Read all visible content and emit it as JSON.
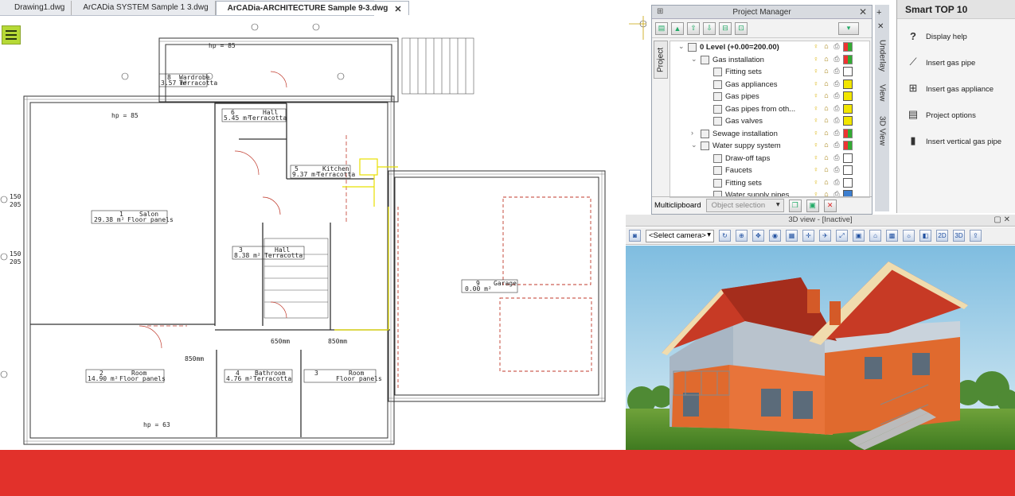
{
  "tabs": [
    {
      "label": "Drawing1.dwg"
    },
    {
      "label": "ArCADia SYSTEM Sample 1 3.dwg"
    },
    {
      "label": "ArCADia-ARCHITECTURE Sample 9-3.dwg",
      "active": true
    }
  ],
  "tab_close_glyph": "✕",
  "drawing": {
    "rooms": [
      {
        "num": "1",
        "name": "Salon",
        "area": "29.38 m²",
        "floor": "Floor panels"
      },
      {
        "num": "8",
        "name": "Wardrobe",
        "area": "3.57 m²",
        "floor": "Terracotta"
      },
      {
        "num": "6",
        "name": "Hall",
        "area": "5.45 m²",
        "floor": "Terracotta"
      },
      {
        "num": "5",
        "name": "Kitchen",
        "area": "9.37 m²",
        "floor": "Terracotta"
      },
      {
        "num": "3",
        "name": "Hall",
        "area": "8.38 m²",
        "floor": "Terracotta"
      },
      {
        "num": "2",
        "name": "Room",
        "area": "14.90 m²",
        "floor": "Floor panels"
      },
      {
        "num": "4",
        "name": "Bathroom",
        "area": "4.76 m²",
        "floor": "Terracotta"
      },
      {
        "num": "3",
        "name": "Room",
        "area": "",
        "floor": "Floor panels"
      },
      {
        "num": "9",
        "name": "Garage",
        "area": "0.00 m²",
        "floor": ""
      }
    ],
    "hp_labels": [
      "hp = 85",
      "hp = 63",
      "hp = 85"
    ],
    "dims": [
      "150",
      "205",
      "150",
      "205",
      "850mm",
      "650mm",
      "850mm"
    ]
  },
  "project_manager": {
    "title": "Project Manager",
    "side_tab": "Project",
    "vertical_tabs": [
      "Underlay",
      "View",
      "3D View"
    ],
    "tree": [
      {
        "level": 0,
        "label": "0  Level (+0.00=200.00)",
        "expanded": true,
        "bold": true,
        "swatch": "multi"
      },
      {
        "level": 1,
        "label": "Gas installation",
        "expanded": true,
        "swatch": "multi"
      },
      {
        "level": 2,
        "label": "Fitting sets",
        "swatch": "white"
      },
      {
        "level": 2,
        "label": "Gas appliances",
        "swatch": "yellow"
      },
      {
        "level": 2,
        "label": "Gas pipes",
        "swatch": "yellow"
      },
      {
        "level": 2,
        "label": "Gas pipes from oth...",
        "swatch": "yellow"
      },
      {
        "level": 2,
        "label": "Gas valves",
        "swatch": "yellow"
      },
      {
        "level": 1,
        "label": "Sewage installation",
        "expanded": false,
        "swatch": "multi"
      },
      {
        "level": 1,
        "label": "Water suppy system",
        "expanded": true,
        "swatch": "multi"
      },
      {
        "level": 2,
        "label": "Draw-off taps",
        "swatch": "white"
      },
      {
        "level": 2,
        "label": "Faucets",
        "swatch": "white"
      },
      {
        "level": 2,
        "label": "Fitting sets",
        "swatch": "white"
      },
      {
        "level": 2,
        "label": "Water supply pipes",
        "swatch": "blue"
      }
    ],
    "bottom": {
      "multiclipboard": "Multiclipboard",
      "object_selection": "Object selection"
    }
  },
  "smart_top": {
    "title": "Smart TOP 10",
    "items": [
      {
        "label": "Display help",
        "icon": "question-icon"
      },
      {
        "label": "Insert gas pipe",
        "icon": "gas-pipe-icon"
      },
      {
        "label": "Insert gas appliance",
        "icon": "gas-appliance-icon"
      },
      {
        "label": "Project options",
        "icon": "document-icon"
      },
      {
        "label": "Insert vertical gas pipe",
        "icon": "vertical-pipe-icon"
      }
    ]
  },
  "view3d": {
    "title": "3D view - [Inactive]",
    "camera": "<Select camera>"
  },
  "colors": {
    "banner": "#e2312b",
    "accent_green": "#b6d936",
    "cad_yellow": "#e8e000",
    "cad_red": "#c0392b"
  }
}
